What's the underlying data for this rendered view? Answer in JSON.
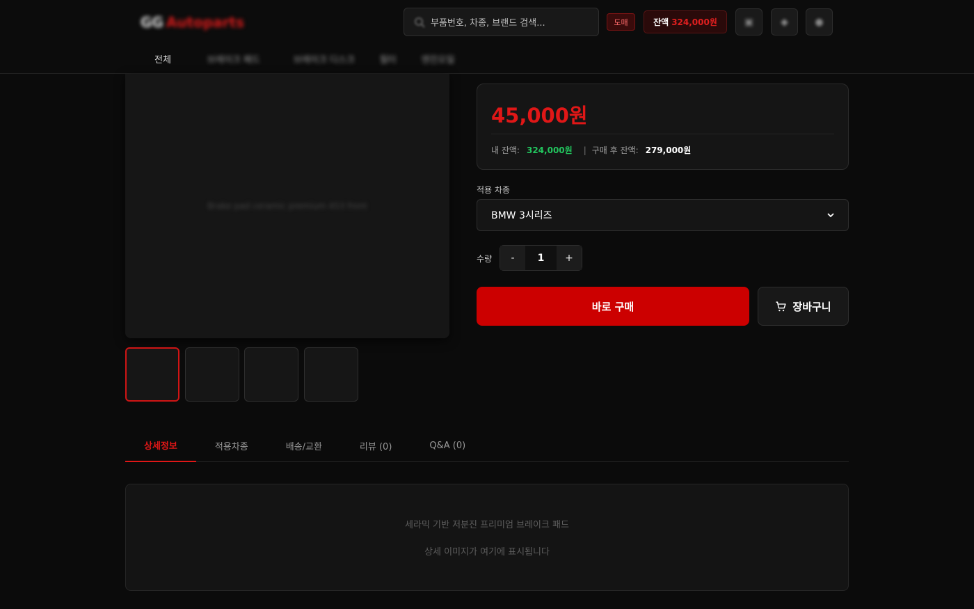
{
  "header": {
    "logo_text_1": "GG",
    "logo_text_2": "Autoparts",
    "search_placeholder": "부품번호, 차종, 브랜드 검색...",
    "wholesale_badge": "도매",
    "balance_label": "잔액",
    "balance_amount": "324,000원",
    "icon_buttons": [
      "cart-icon",
      "bell-icon",
      "user-icon"
    ]
  },
  "nav": {
    "items": [
      "전체",
      "브레이크 패드",
      "브레이크 디스크",
      "필터",
      "엔진오일"
    ]
  },
  "gallery": {
    "main_placeholder": "Brake pad ceramic premium 453 front"
  },
  "product": {
    "price": "45,000원",
    "my_balance_label": "내 잔액:",
    "my_balance_value": "324,000원",
    "separator": "|",
    "after_balance_label": "구매 후 잔액:",
    "after_balance_value": "279,000원",
    "vehicle_label": "적용 차종",
    "vehicle_selected": "BMW 3시리즈",
    "quantity_label": "수량",
    "quantity_minus": "-",
    "quantity_value": "1",
    "quantity_plus": "+",
    "buy_label": "바로 구매",
    "cart_label": "장바구니"
  },
  "tabs": [
    {
      "label": "상세정보",
      "active": true
    },
    {
      "label": "적용차종",
      "active": false
    },
    {
      "label": "배송/교환",
      "active": false
    },
    {
      "label": "리뷰 (0)",
      "active": false
    },
    {
      "label": "Q&A (0)",
      "active": false
    }
  ],
  "detail": {
    "line1": "세라믹 기반 저분진 프리미엄 브레이크 패드",
    "line2": "상세 이미지가 여기에 표시됩니다"
  },
  "colors": {
    "accent": "#e01717",
    "buy_button": "#cc0000",
    "balance_green": "#22c55e",
    "background": "#0b0b0b"
  }
}
